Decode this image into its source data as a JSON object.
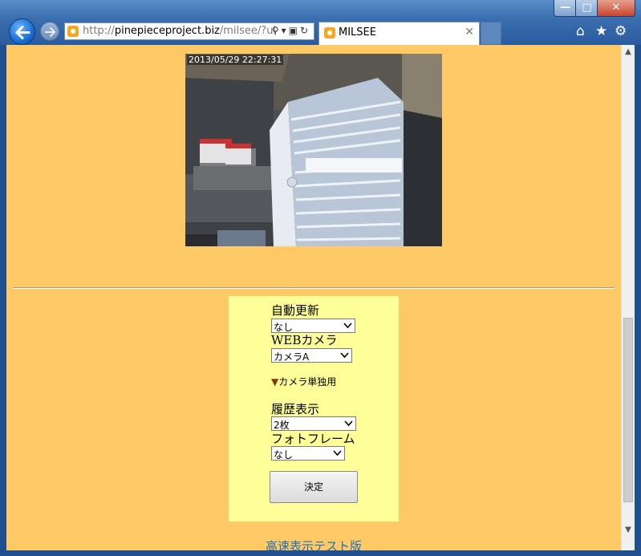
{
  "browser": {
    "address": {
      "scheme": "http://",
      "host": "pinepieceproject.biz",
      "path": "/milsee/?ui"
    },
    "tab": {
      "title": "MILSEE"
    }
  },
  "camera": {
    "timestamp": "2013/05/29 22:27:31"
  },
  "form": {
    "auto_update": {
      "label": "自動更新",
      "value": "なし"
    },
    "web_camera": {
      "label": "WEBカメラ",
      "value": "カメラA"
    },
    "camera_note": {
      "marker": "▼",
      "text": "カメラ単独用"
    },
    "history": {
      "label": "履歴表示",
      "value": "2枚"
    },
    "photo_frame": {
      "label": "フォトフレーム",
      "value": "なし"
    },
    "submit_label": "決定"
  },
  "footer": {
    "link_text": "高速表示テスト版"
  },
  "colors": {
    "page_bg": "#ffc966",
    "panel_bg": "#ffff99",
    "link": "#1f6fb8"
  }
}
